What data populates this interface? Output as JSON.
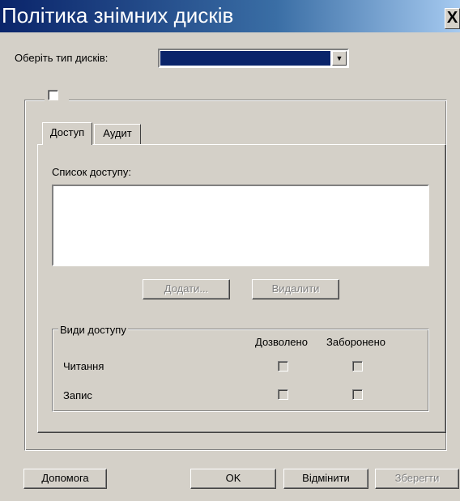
{
  "window": {
    "title": "Політика знімних дисків",
    "close_label": "X"
  },
  "disk_type": {
    "label": "Оберіть тип дисків:",
    "selected_value": ""
  },
  "tabs": [
    {
      "label": "Доступ",
      "active": true
    },
    {
      "label": "Аудит",
      "active": false
    }
  ],
  "access_list": {
    "label": "Список доступу:",
    "items": []
  },
  "list_buttons": {
    "add": "Додати...",
    "remove": "Видалити"
  },
  "access_types": {
    "label": "Види доступу",
    "columns": [
      "Дозволено",
      "Заборонено"
    ],
    "rows": [
      {
        "label": "Читання",
        "allowed": false,
        "denied": false
      },
      {
        "label": "Запис",
        "allowed": false,
        "denied": false
      }
    ]
  },
  "footer_buttons": {
    "help": "Допомога",
    "ok": "OK",
    "cancel": "Відмінити",
    "save": "Зберегти"
  }
}
